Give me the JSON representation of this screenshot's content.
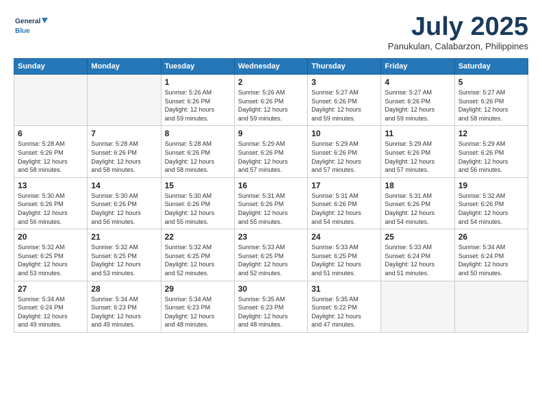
{
  "logo": {
    "line1": "General",
    "line2": "Blue"
  },
  "title": "July 2025",
  "subtitle": "Panukulan, Calabarzon, Philippines",
  "headers": [
    "Sunday",
    "Monday",
    "Tuesday",
    "Wednesday",
    "Thursday",
    "Friday",
    "Saturday"
  ],
  "weeks": [
    [
      {
        "day": "",
        "info": ""
      },
      {
        "day": "",
        "info": ""
      },
      {
        "day": "1",
        "info": "Sunrise: 5:26 AM\nSunset: 6:26 PM\nDaylight: 12 hours\nand 59 minutes."
      },
      {
        "day": "2",
        "info": "Sunrise: 5:26 AM\nSunset: 6:26 PM\nDaylight: 12 hours\nand 59 minutes."
      },
      {
        "day": "3",
        "info": "Sunrise: 5:27 AM\nSunset: 6:26 PM\nDaylight: 12 hours\nand 59 minutes."
      },
      {
        "day": "4",
        "info": "Sunrise: 5:27 AM\nSunset: 6:26 PM\nDaylight: 12 hours\nand 59 minutes."
      },
      {
        "day": "5",
        "info": "Sunrise: 5:27 AM\nSunset: 6:26 PM\nDaylight: 12 hours\nand 58 minutes."
      }
    ],
    [
      {
        "day": "6",
        "info": "Sunrise: 5:28 AM\nSunset: 6:26 PM\nDaylight: 12 hours\nand 58 minutes."
      },
      {
        "day": "7",
        "info": "Sunrise: 5:28 AM\nSunset: 6:26 PM\nDaylight: 12 hours\nand 58 minutes."
      },
      {
        "day": "8",
        "info": "Sunrise: 5:28 AM\nSunset: 6:26 PM\nDaylight: 12 hours\nand 58 minutes."
      },
      {
        "day": "9",
        "info": "Sunrise: 5:29 AM\nSunset: 6:26 PM\nDaylight: 12 hours\nand 57 minutes."
      },
      {
        "day": "10",
        "info": "Sunrise: 5:29 AM\nSunset: 6:26 PM\nDaylight: 12 hours\nand 57 minutes."
      },
      {
        "day": "11",
        "info": "Sunrise: 5:29 AM\nSunset: 6:26 PM\nDaylight: 12 hours\nand 57 minutes."
      },
      {
        "day": "12",
        "info": "Sunrise: 5:29 AM\nSunset: 6:26 PM\nDaylight: 12 hours\nand 56 minutes."
      }
    ],
    [
      {
        "day": "13",
        "info": "Sunrise: 5:30 AM\nSunset: 6:26 PM\nDaylight: 12 hours\nand 56 minutes."
      },
      {
        "day": "14",
        "info": "Sunrise: 5:30 AM\nSunset: 6:26 PM\nDaylight: 12 hours\nand 56 minutes."
      },
      {
        "day": "15",
        "info": "Sunrise: 5:30 AM\nSunset: 6:26 PM\nDaylight: 12 hours\nand 55 minutes."
      },
      {
        "day": "16",
        "info": "Sunrise: 5:31 AM\nSunset: 6:26 PM\nDaylight: 12 hours\nand 55 minutes."
      },
      {
        "day": "17",
        "info": "Sunrise: 5:31 AM\nSunset: 6:26 PM\nDaylight: 12 hours\nand 54 minutes."
      },
      {
        "day": "18",
        "info": "Sunrise: 5:31 AM\nSunset: 6:26 PM\nDaylight: 12 hours\nand 54 minutes."
      },
      {
        "day": "19",
        "info": "Sunrise: 5:32 AM\nSunset: 6:26 PM\nDaylight: 12 hours\nand 54 minutes."
      }
    ],
    [
      {
        "day": "20",
        "info": "Sunrise: 5:32 AM\nSunset: 6:25 PM\nDaylight: 12 hours\nand 53 minutes."
      },
      {
        "day": "21",
        "info": "Sunrise: 5:32 AM\nSunset: 6:25 PM\nDaylight: 12 hours\nand 53 minutes."
      },
      {
        "day": "22",
        "info": "Sunrise: 5:32 AM\nSunset: 6:25 PM\nDaylight: 12 hours\nand 52 minutes."
      },
      {
        "day": "23",
        "info": "Sunrise: 5:33 AM\nSunset: 6:25 PM\nDaylight: 12 hours\nand 52 minutes."
      },
      {
        "day": "24",
        "info": "Sunrise: 5:33 AM\nSunset: 6:25 PM\nDaylight: 12 hours\nand 51 minutes."
      },
      {
        "day": "25",
        "info": "Sunrise: 5:33 AM\nSunset: 6:24 PM\nDaylight: 12 hours\nand 51 minutes."
      },
      {
        "day": "26",
        "info": "Sunrise: 5:34 AM\nSunset: 6:24 PM\nDaylight: 12 hours\nand 50 minutes."
      }
    ],
    [
      {
        "day": "27",
        "info": "Sunrise: 5:34 AM\nSunset: 6:24 PM\nDaylight: 12 hours\nand 49 minutes."
      },
      {
        "day": "28",
        "info": "Sunrise: 5:34 AM\nSunset: 6:23 PM\nDaylight: 12 hours\nand 49 minutes."
      },
      {
        "day": "29",
        "info": "Sunrise: 5:34 AM\nSunset: 6:23 PM\nDaylight: 12 hours\nand 48 minutes."
      },
      {
        "day": "30",
        "info": "Sunrise: 5:35 AM\nSunset: 6:23 PM\nDaylight: 12 hours\nand 48 minutes."
      },
      {
        "day": "31",
        "info": "Sunrise: 5:35 AM\nSunset: 6:22 PM\nDaylight: 12 hours\nand 47 minutes."
      },
      {
        "day": "",
        "info": ""
      },
      {
        "day": "",
        "info": ""
      }
    ]
  ]
}
